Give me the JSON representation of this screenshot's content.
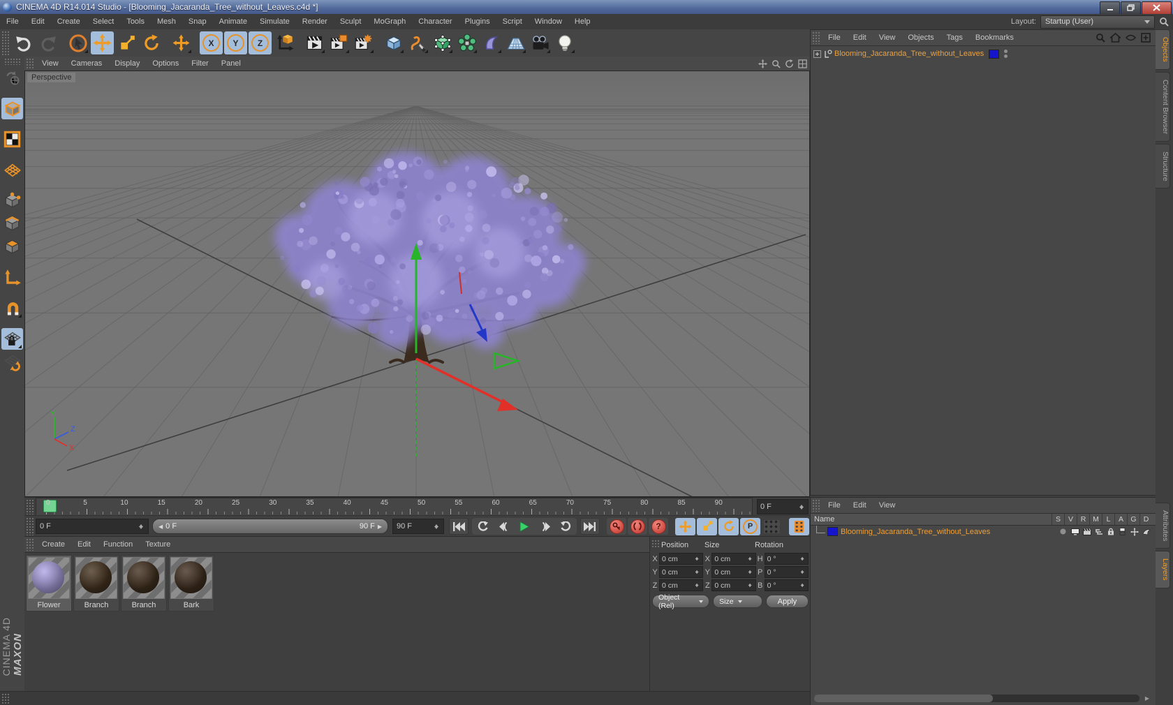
{
  "titlebar": {
    "title": "CINEMA 4D R14.014 Studio - [Blooming_Jacaranda_Tree_without_Leaves.c4d *]"
  },
  "menubar": {
    "items": [
      "File",
      "Edit",
      "Create",
      "Select",
      "Tools",
      "Mesh",
      "Snap",
      "Animate",
      "Simulate",
      "Render",
      "Sculpt",
      "MoGraph",
      "Character",
      "Plugins",
      "Script",
      "Window",
      "Help"
    ],
    "layout_label": "Layout:",
    "layout_value": "Startup (User)"
  },
  "toolbar": {
    "axis_letters": [
      "X",
      "Y",
      "Z"
    ]
  },
  "viewport": {
    "menus": [
      "View",
      "Cameras",
      "Display",
      "Options",
      "Filter",
      "Panel"
    ],
    "camera_label": "Perspective",
    "axis": {
      "x": "X",
      "y": "Y",
      "z": "Z"
    }
  },
  "object_manager": {
    "menus": [
      "File",
      "Edit",
      "View",
      "Objects",
      "Tags",
      "Bookmarks"
    ],
    "object_name": "Blooming_Jacaranda_Tree_without_Leaves",
    "layer_color": "#1515cd",
    "side_tabs": [
      "Objects",
      "Content Browser",
      "Structure"
    ]
  },
  "layers_panel": {
    "menus": [
      "File",
      "Edit",
      "View"
    ],
    "name_header": "Name",
    "columns": [
      "S",
      "V",
      "R",
      "M",
      "L",
      "A",
      "G",
      "D"
    ],
    "object_name": "Blooming_Jacaranda_Tree_without_Leaves",
    "layer_color": "#1515cd",
    "side_tabs": [
      "Attributes",
      "Layers"
    ]
  },
  "timeline": {
    "labels": [
      "0",
      "5",
      "10",
      "15",
      "20",
      "25",
      "30",
      "35",
      "40",
      "45",
      "50",
      "55",
      "60",
      "65",
      "70",
      "75",
      "80",
      "85",
      "90"
    ],
    "frame_field": "0 F",
    "start_field": "0 F",
    "range_start": "0 F",
    "range_end": "90 F",
    "end_field": "90 F",
    "p_label": "P",
    "help_label": "?"
  },
  "materials": {
    "menus": [
      "Create",
      "Edit",
      "Function",
      "Texture"
    ],
    "items": [
      {
        "label": "Flower",
        "color": "#b1a6e6"
      },
      {
        "label": "Branch",
        "color": "#4a3723"
      },
      {
        "label": "Branch",
        "color": "#453321"
      },
      {
        "label": "Bark",
        "color": "#443222"
      }
    ]
  },
  "coordinates": {
    "headers": [
      "Position",
      "Size",
      "Rotation"
    ],
    "rows": [
      {
        "pl": "X",
        "pv": "0 cm",
        "sl": "X",
        "sv": "0 cm",
        "rl": "H",
        "rv": "0 °"
      },
      {
        "pl": "Y",
        "pv": "0 cm",
        "sl": "Y",
        "sv": "0 cm",
        "rl": "P",
        "rv": "0 °"
      },
      {
        "pl": "Z",
        "pv": "0 cm",
        "sl": "Z",
        "sv": "0 cm",
        "rl": "B",
        "rv": "0 °"
      }
    ],
    "mode_object": "Object (Rel)",
    "mode_size": "Size",
    "apply": "Apply"
  },
  "branding": {
    "line1": "MAXON",
    "line2": "CINEMA 4D"
  }
}
